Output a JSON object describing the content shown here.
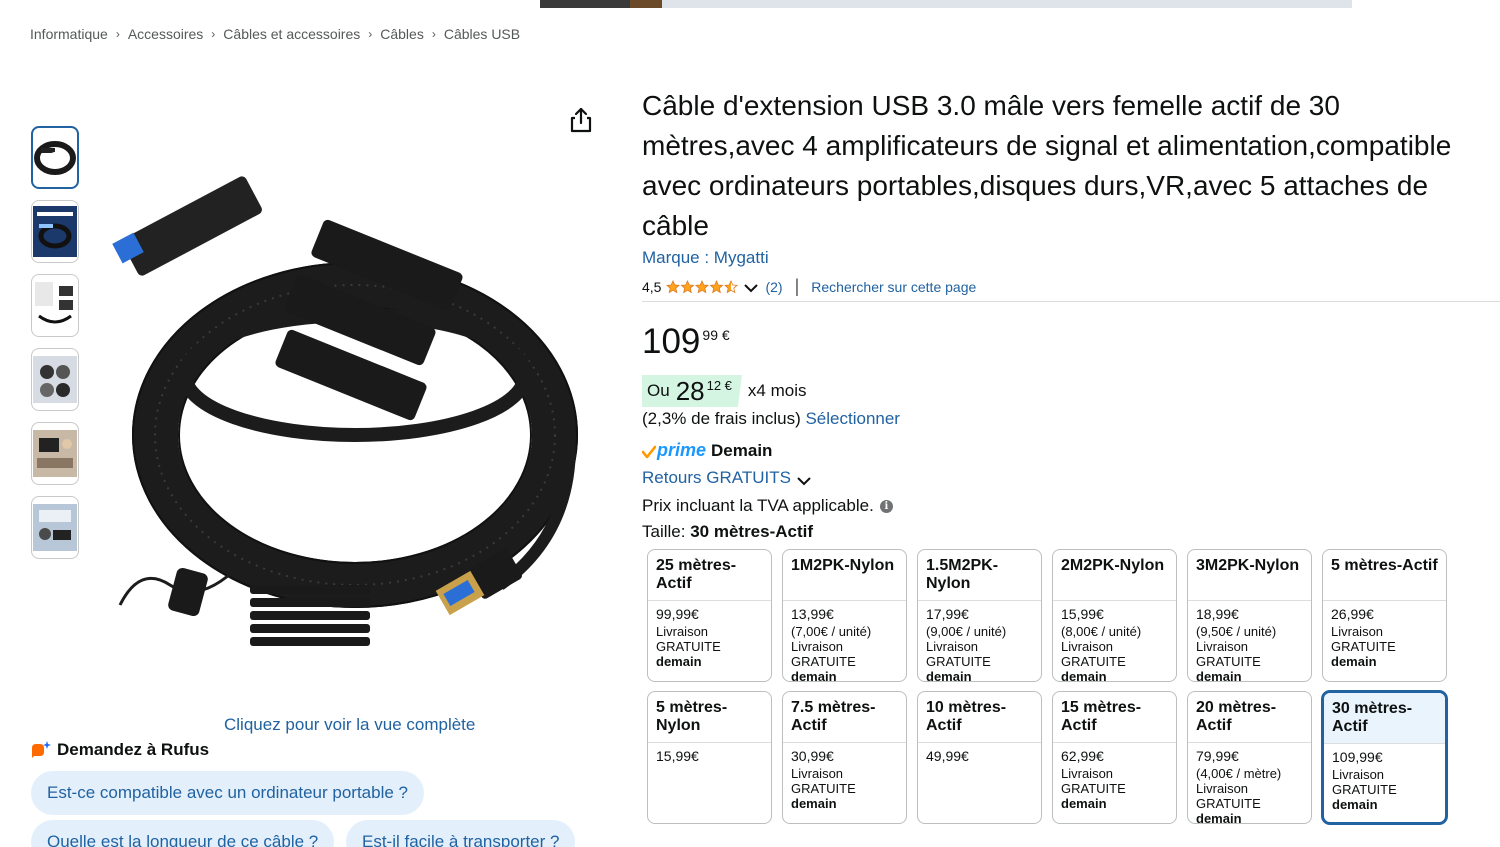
{
  "breadcrumb": [
    "Informatique",
    "Accessoires",
    "Câbles et accessoires",
    "Câbles",
    "Câbles USB"
  ],
  "breadcrumb_separator": "›",
  "gallery": {
    "thumbnails": [
      "thumb-1",
      "thumb-2",
      "thumb-3",
      "thumb-4",
      "thumb-5",
      "thumb-6"
    ],
    "selected_index": 0,
    "view_full_label": "Cliquez pour voir la vue complète",
    "share_icon": "share-icon"
  },
  "rufus": {
    "heading": "Demandez à Rufus",
    "questions": [
      "Est-ce compatible avec un ordinateur portable ?",
      "Quelle est la longueur de ce câble ?",
      "Est-il facile à transporter ?"
    ]
  },
  "product": {
    "title": "Câble d'extension USB 3.0 mâle vers femelle actif de 30 mètres,avec 4 amplificateurs de signal et alimentation,compatible avec ordinateurs portables,disques durs,VR,avec 5 attaches de câble",
    "brand": "Marque : Mygatti",
    "rating_value": "4,5",
    "rating_stars": 4.5,
    "rating_count": "(2)",
    "search_page_label": "Rechercher sur cette page",
    "price_whole": "109",
    "price_fraction": "99 €",
    "installment_prefix": "Ou",
    "installment_whole": "28",
    "installment_fraction": "12 €",
    "installment_suffix": "x4 mois",
    "fees_text": "(2,3% de frais inclus)",
    "fees_link": "Sélectionner",
    "prime_label": "prime",
    "prime_delivery": "Demain",
    "returns_label": "Retours GRATUITS",
    "vat_text": "Prix incluant la TVA applicable.",
    "size_prefix": "Taille:",
    "size_value": "30 mètres-Actif"
  },
  "colors": {
    "link": "#2162a1",
    "star": "#ffa41c",
    "prime": "#1a98ff",
    "installment_bg": "#d5f5e3",
    "chip_bg": "#e3f0fb"
  },
  "size_options": [
    {
      "name": "25 mètres-Actif",
      "price": "99,99€",
      "unit": "",
      "delivery": "Livraison",
      "delivery2": "GRATUITE",
      "delivery_bold": "demain"
    },
    {
      "name": "1M2PK-Nylon",
      "price": "13,99€",
      "unit": "(7,00€ / unité)",
      "delivery": "Livraison",
      "delivery2": "GRATUITE",
      "delivery_bold": "demain"
    },
    {
      "name": "1.5M2PK-Nylon",
      "price": "17,99€",
      "unit": "(9,00€ / unité)",
      "delivery": "Livraison",
      "delivery2": "GRATUITE",
      "delivery_bold": "demain"
    },
    {
      "name": "2M2PK-Nylon",
      "price": "15,99€",
      "unit": "(8,00€ / unité)",
      "delivery": "Livraison",
      "delivery2": "GRATUITE",
      "delivery_bold": "demain"
    },
    {
      "name": "3M2PK-Nylon",
      "price": "18,99€",
      "unit": "(9,50€ / unité)",
      "delivery": "Livraison",
      "delivery2": "GRATUITE",
      "delivery_bold": "demain"
    },
    {
      "name": "5 mètres-Actif",
      "price": "26,99€",
      "unit": "",
      "delivery": "Livraison",
      "delivery2": "GRATUITE",
      "delivery_bold": "demain"
    },
    {
      "name": "5 mètres-Nylon",
      "price": "15,99€",
      "unit": "",
      "delivery": "",
      "delivery2": "",
      "delivery_bold": ""
    },
    {
      "name": "7.5 mètres-Actif",
      "price": "30,99€",
      "unit": "",
      "delivery": "Livraison",
      "delivery2": "GRATUITE",
      "delivery_bold": "demain"
    },
    {
      "name": "10 mètres-Actif",
      "price": "49,99€",
      "unit": "",
      "delivery": "",
      "delivery2": "",
      "delivery_bold": ""
    },
    {
      "name": "15 mètres-Actif",
      "price": "62,99€",
      "unit": "",
      "delivery": "Livraison",
      "delivery2": "GRATUITE",
      "delivery_bold": "demain"
    },
    {
      "name": "20 mètres-Actif",
      "price": "79,99€",
      "unit": "(4,00€ / mètre)",
      "delivery": "Livraison",
      "delivery2": "GRATUITE",
      "delivery_bold": "demain"
    },
    {
      "name": "30 mètres-Actif",
      "price": "109,99€",
      "unit": "",
      "delivery": "Livraison",
      "delivery2": "GRATUITE",
      "delivery_bold": "demain",
      "selected": true
    }
  ]
}
